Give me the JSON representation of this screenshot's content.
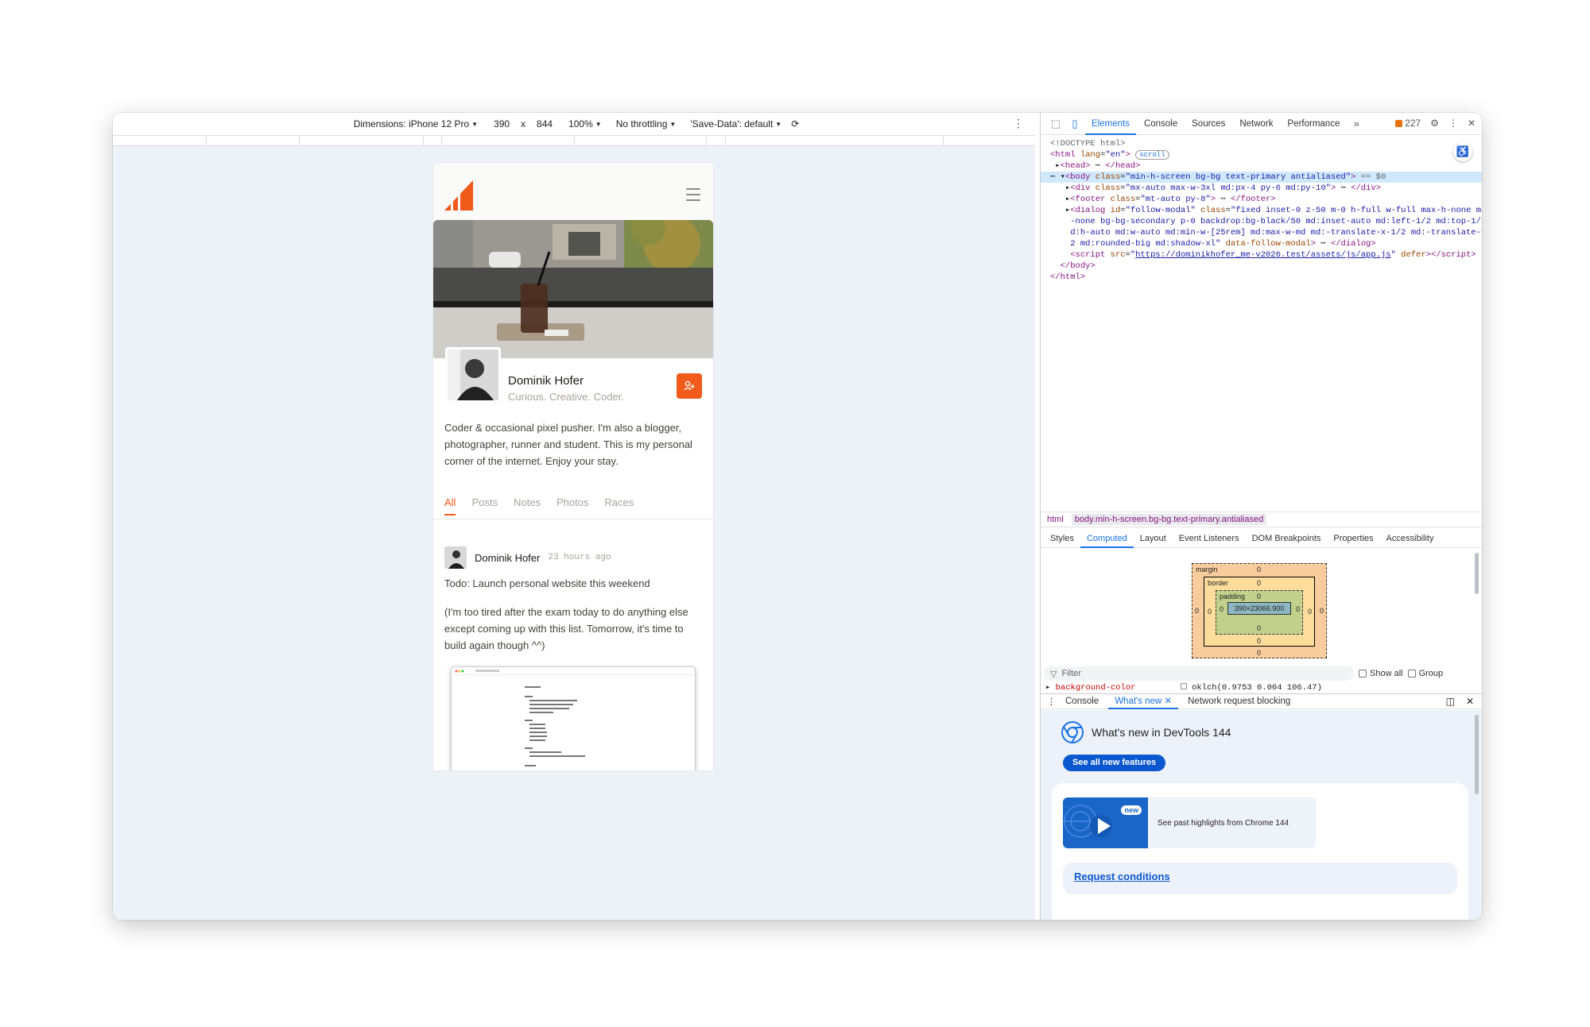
{
  "device_toolbar": {
    "dimensions_label": "Dimensions: iPhone 12 Pro",
    "width": "390",
    "times": "x",
    "height": "844",
    "zoom": "100%",
    "throttling": "No throttling",
    "save_data": "'Save-Data': default"
  },
  "page": {
    "name": "Dominik Hofer",
    "tagline": "Curious. Creative. Coder.",
    "bio": "Coder & occasional pixel pusher. I'm also a blogger, photographer, runner and student. This is my personal corner of the internet. Enjoy your stay.",
    "tabs": [
      "All",
      "Posts",
      "Notes",
      "Photos",
      "Races"
    ],
    "post": {
      "author": "Dominik Hofer",
      "time": "23 hours ago",
      "line1": "Todo: Launch personal website this weekend",
      "line2": "(I'm too tired after the exam today to do anything else except coming up with this list. Tomorrow, it's time to build again though ^^)"
    }
  },
  "devtools": {
    "tabs": [
      "Elements",
      "Console",
      "Sources",
      "Network",
      "Performance"
    ],
    "issues_count": "227",
    "code": {
      "doctype": "<!DOCTYPE html>",
      "scroll_badge": "scroll",
      "src_url": "https://dominikhofer_me-v2026.test/assets/js/app.js"
    },
    "breadcrumbs": [
      "html",
      "body.min-h-screen.bg-bg.text-primary.antialiased"
    ],
    "subtabs": [
      "Styles",
      "Computed",
      "Layout",
      "Event Listeners",
      "DOM Breakpoints",
      "Properties",
      "Accessibility"
    ],
    "box_model": {
      "margin": "margin",
      "border": "border",
      "padding": "padding",
      "content": "390×23066.900",
      "zero": "0"
    },
    "filter_placeholder": "Filter",
    "show_all": "Show all",
    "group": "Group",
    "property": {
      "name": "background-color",
      "value": "oklch(0.9753 0.004 106.47)"
    },
    "drawer_tabs": [
      "Console",
      "What's new",
      "Network request blocking"
    ],
    "whats_new": {
      "title": "What's new in DevTools 144",
      "button": "See all new features",
      "badge": "new",
      "video_text": "See past highlights from Chrome 144",
      "link": "Request conditions"
    }
  }
}
